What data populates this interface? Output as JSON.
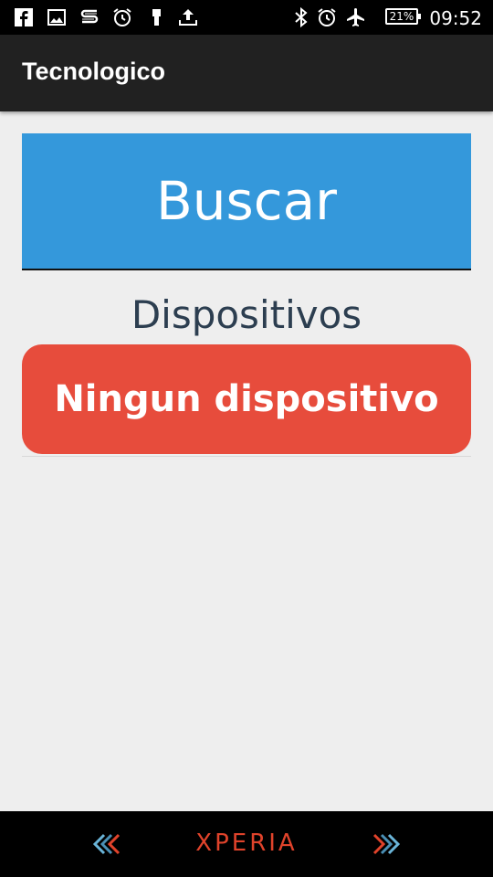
{
  "status_bar": {
    "time": "09:52",
    "battery": "21%",
    "left_icons": [
      "facebook-icon",
      "gallery-icon",
      "sony-s-icon",
      "alarm-clock-icon",
      "usb-icon",
      "upload-icon"
    ],
    "right_icons": [
      "bluetooth-icon",
      "alarm-icon",
      "airplane-mode-icon"
    ]
  },
  "app_bar": {
    "title": "Tecnologico"
  },
  "main": {
    "search_button_label": "Buscar",
    "devices_heading": "Dispositivos",
    "devices": [
      "Ningun dispositivo"
    ]
  },
  "nav_bar": {
    "brand": "XPERIA"
  },
  "colors": {
    "search_button": "#3498db",
    "device_item": "#e74c3c",
    "heading_text": "#2c3e50",
    "app_bar": "#212121",
    "background": "#eeeeee",
    "brand_text": "#e0432b"
  }
}
